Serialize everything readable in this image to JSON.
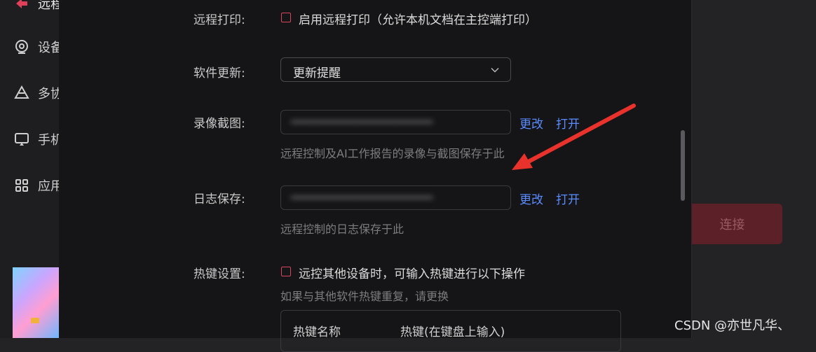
{
  "sidebar": {
    "items": [
      {
        "label": "远程",
        "icon": "remote-icon",
        "color": "#e0405a"
      },
      {
        "label": "设备",
        "icon": "device-icon"
      },
      {
        "label": "多协",
        "icon": "multi-collab-icon"
      },
      {
        "label": "手机",
        "icon": "phone-cast-icon"
      },
      {
        "label": "应用",
        "icon": "apps-grid-icon"
      }
    ]
  },
  "background": {
    "connect_label": "连接"
  },
  "settings": {
    "remote_print": {
      "label": "远程打印:",
      "checkbox_text": "启用远程打印（允许本机文档在主控端打印）",
      "checked": false
    },
    "software_update": {
      "label": "软件更新:",
      "selected": "更新提醒"
    },
    "recording": {
      "label": "录像截图:",
      "change": "更改",
      "open": "打开",
      "hint": "远程控制及AI工作报告的录像与截图保存于此"
    },
    "log_save": {
      "label": "日志保存:",
      "change": "更改",
      "open": "打开",
      "hint": "远程控制的日志保存于此"
    },
    "hotkey": {
      "label": "热键设置:",
      "checkbox_text": "远控其他设备时，可输入热键进行以下操作",
      "checked": false,
      "hint": "如果与其他软件热键重复，请更换",
      "columns": [
        "热键名称",
        "热键(在键盘上输入)"
      ]
    }
  },
  "watermark": "CSDN @亦世凡华、",
  "colors": {
    "accent": "#d9475e",
    "link": "#5a8cff",
    "annotation_arrow": "#e8322b"
  }
}
